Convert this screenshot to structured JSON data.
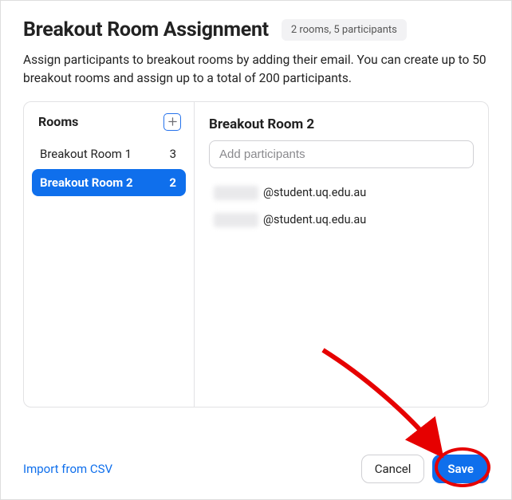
{
  "header": {
    "title": "Breakout Room Assignment",
    "summary": "2 rooms, 5 participants"
  },
  "description": "Assign participants to breakout rooms by adding their email. You can create up to 50 breakout rooms and assign up to a total of 200 participants.",
  "rooms": {
    "heading": "Rooms",
    "items": [
      {
        "name": "Breakout Room 1",
        "count": "3",
        "selected": false
      },
      {
        "name": "Breakout Room 2",
        "count": "2",
        "selected": true
      }
    ]
  },
  "detail": {
    "title": "Breakout Room 2",
    "add_placeholder": "Add participants",
    "participants": [
      {
        "domain": "@student.uq.edu.au"
      },
      {
        "domain": "@student.uq.edu.au"
      }
    ]
  },
  "footer": {
    "import_label": "Import from CSV",
    "cancel_label": "Cancel",
    "save_label": "Save"
  }
}
